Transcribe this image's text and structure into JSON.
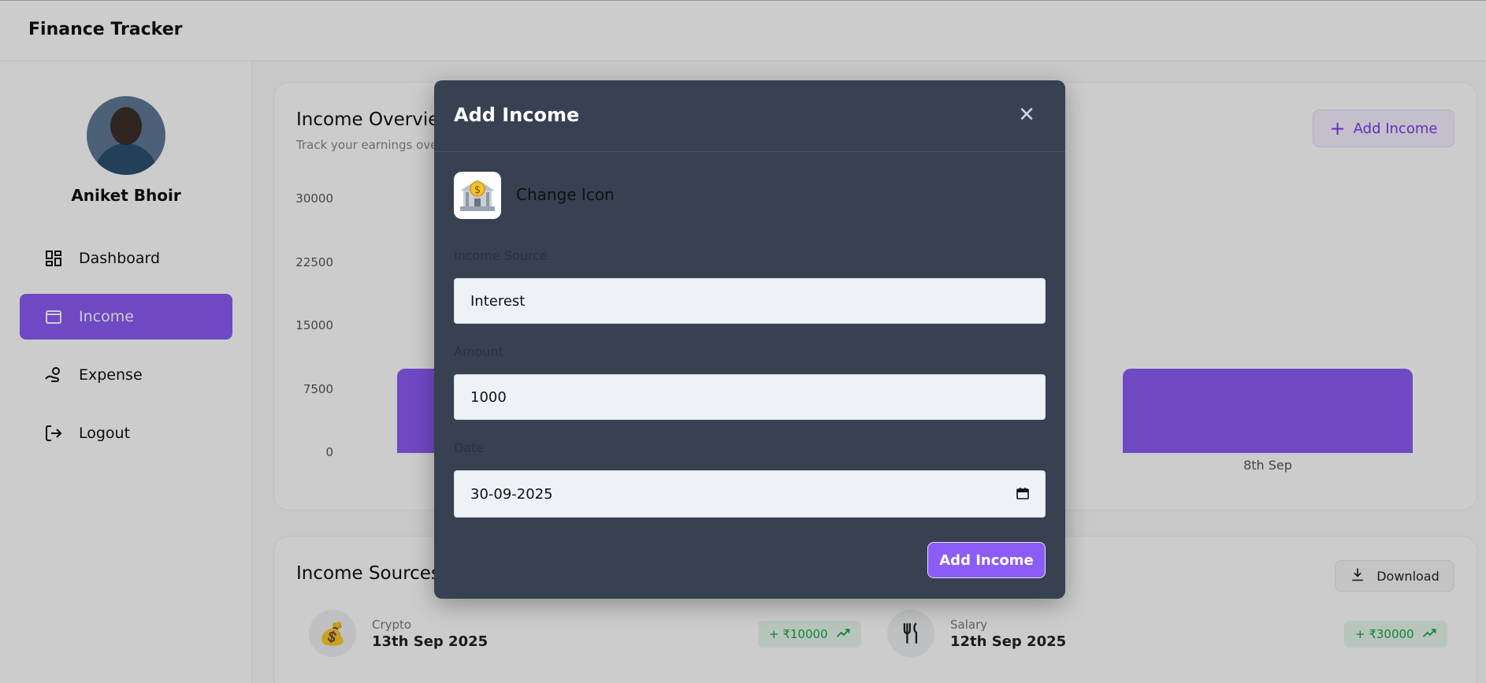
{
  "app": {
    "title": "Finance Tracker"
  },
  "user": {
    "name": "Aniket Bhoir"
  },
  "sidebar": {
    "items": [
      {
        "label": "Dashboard",
        "icon": "dashboard-icon"
      },
      {
        "label": "Income",
        "icon": "wallet-icon",
        "active": true
      },
      {
        "label": "Expense",
        "icon": "hand-coins-icon"
      },
      {
        "label": "Logout",
        "icon": "logout-icon"
      }
    ]
  },
  "overview": {
    "title": "Income Overview",
    "subtitle": "Track your earnings over time and analyze your income trends.",
    "add_button": "Add Income"
  },
  "chart_data": {
    "type": "bar",
    "categories": [
      "",
      "8th Sep"
    ],
    "values": [
      10000,
      10000
    ],
    "yticks": [
      "30000",
      "22500",
      "15000",
      "7500",
      "0"
    ],
    "ylim": [
      0,
      30000
    ],
    "bar_color": "#8b5cf6"
  },
  "sources": {
    "title": "Income Sources",
    "download_label": "Download",
    "items": [
      {
        "name": "Crypto",
        "date": "13th Sep 2025",
        "amount": "+ ₹10000",
        "icon": "money-bag-icon"
      },
      {
        "name": "Salary",
        "date": "12th Sep 2025",
        "amount": "+ ₹30000",
        "icon": "fork-knife-icon"
      }
    ]
  },
  "modal": {
    "title": "Add Income",
    "change_icon_label": "Change Icon",
    "source_label": "Income Source",
    "source_value": "Interest",
    "amount_label": "Amount",
    "amount_value": "1000",
    "date_label": "Date",
    "date_value": "30-09-2025",
    "submit_label": "Add Income",
    "selected_icon": "bank-icon"
  },
  "colors": {
    "accent": "#8b5cf6",
    "modal_bg": "#374151",
    "positive": "#16a34a"
  }
}
